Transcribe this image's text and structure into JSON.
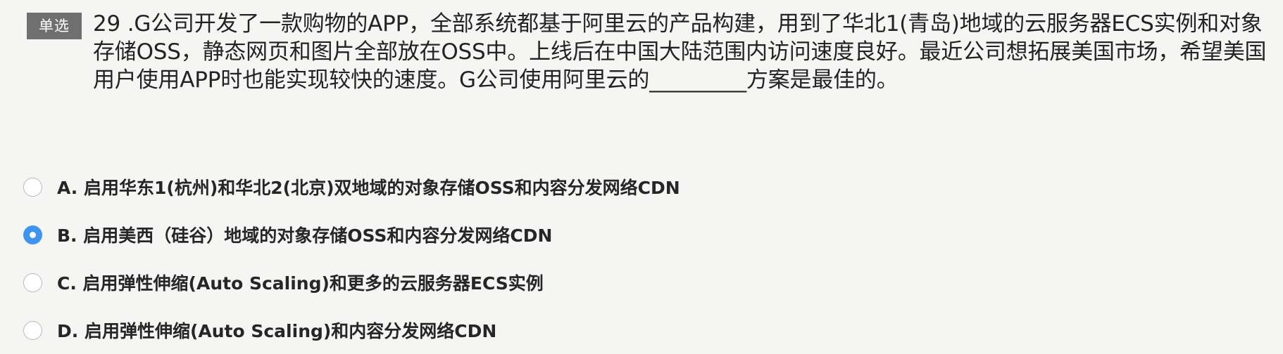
{
  "question": {
    "type_badge": "单选",
    "stem": "29 .G公司开发了一款购物的APP，全部系统都基于阿里云的产品构建，用到了华北1(青岛)地域的云服务器ECS实例和对象存储OSS，静态网页和图片全部放在OSS中。上线后在中国大陆范围内访问速度良好。最近公司想拓展美国市场，希望美国用户使用APP时也能实现较快的速度。G公司使用阿里云的_________方案是最佳的。"
  },
  "options": [
    {
      "label": "A. 启用华东1(杭州)和华北2(北京)双地域的对象存储OSS和内容分发网络CDN",
      "selected": false
    },
    {
      "label": "B. 启用美西（硅谷）地域的对象存储OSS和内容分发网络CDN",
      "selected": true
    },
    {
      "label": "C. 启用弹性伸缩(Auto Scaling)和更多的云服务器ECS实例",
      "selected": false
    },
    {
      "label": "D. 启用弹性伸缩(Auto Scaling)和内容分发网络CDN",
      "selected": false
    }
  ],
  "colors": {
    "accent": "#3e94ee",
    "badge_bg": "#6f6f6f",
    "background": "#f5f5f4"
  }
}
